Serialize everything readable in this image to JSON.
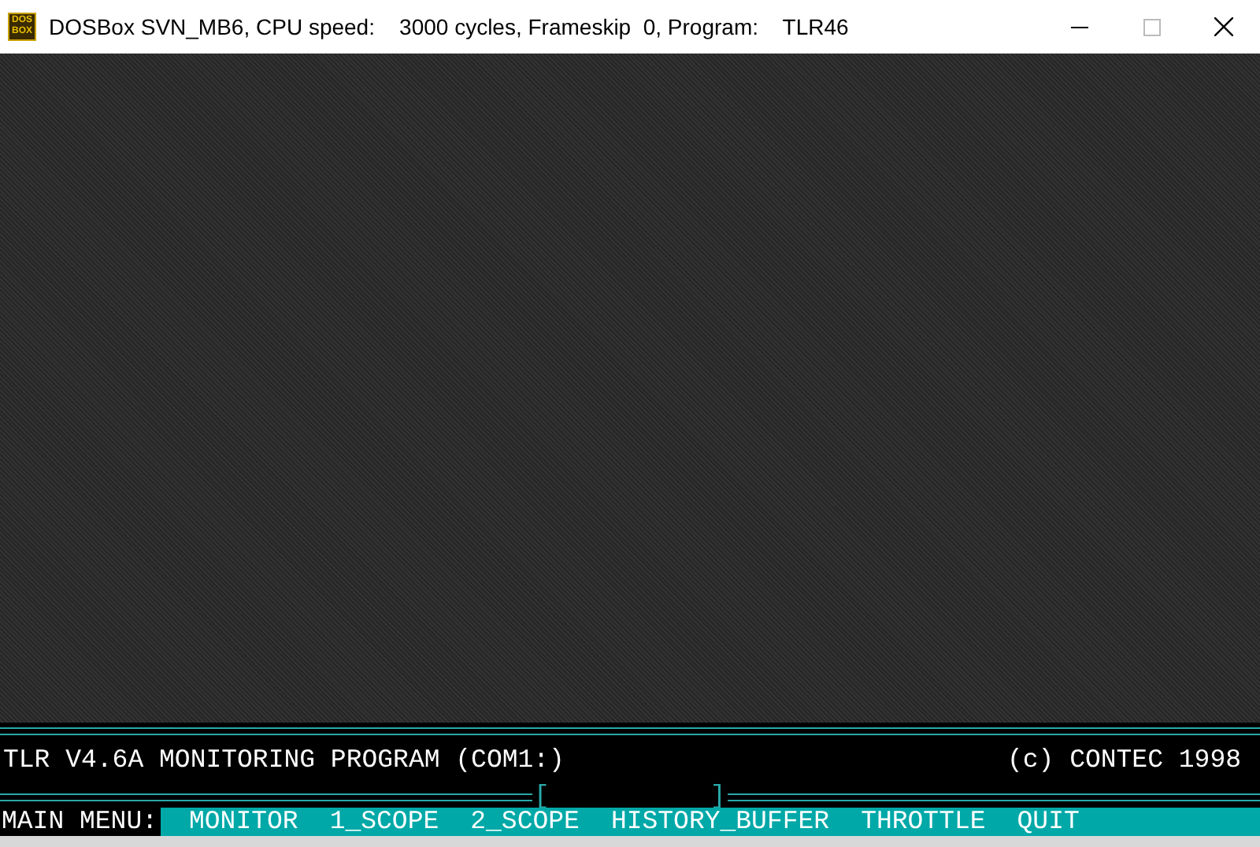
{
  "window": {
    "title": "DOSBox SVN_MB6, CPU speed:    3000 cycles, Frameskip  0, Program:    TLR46",
    "app_icon": "DOS BOX"
  },
  "header": {
    "title": "TLR V4.6A MONITORING PROGRAM (COM1:)",
    "copyright": "(c) CONTEC 1998",
    "bracket_open": "[",
    "bracket_close": "]"
  },
  "menu": {
    "label": "MAIN MENU:",
    "items": [
      {
        "label": "MONITOR",
        "selected": false
      },
      {
        "label": "1_SCOPE",
        "selected": false
      },
      {
        "label": "2_SCOPE",
        "selected": false
      },
      {
        "label": "HISTORY_BUFFER",
        "selected": false
      },
      {
        "label": "THROTTLE",
        "selected": false
      },
      {
        "label": "QUIT",
        "selected": false
      }
    ]
  }
}
